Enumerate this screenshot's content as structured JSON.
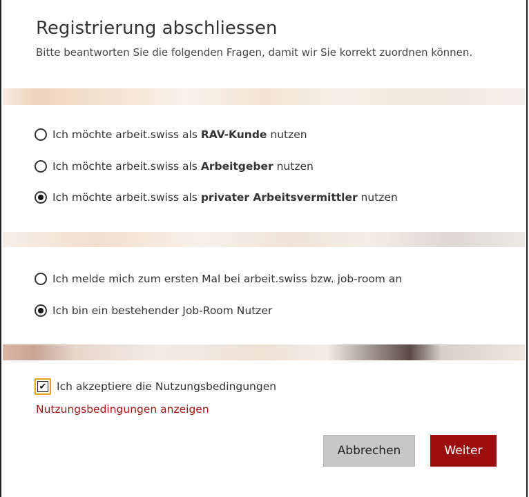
{
  "header": {
    "title": "Registrierung abschliessen",
    "subtitle": "Bitte beantworten Sie die folgenden Fragen, damit wir Sie korrekt zuordnen können."
  },
  "role_options": [
    {
      "prefix": "Ich möchte arbeit.swiss als ",
      "bold": "RAV-Kunde",
      "suffix": " nutzen",
      "checked": false
    },
    {
      "prefix": "Ich möchte arbeit.swiss als ",
      "bold": "Arbeitgeber",
      "suffix": " nutzen",
      "checked": false
    },
    {
      "prefix": "Ich möchte arbeit.swiss als ",
      "bold": "privater Arbeitsvermittler",
      "suffix": " nutzen",
      "checked": true
    }
  ],
  "user_options": [
    {
      "label": "Ich melde mich zum ersten Mal bei arbeit.swiss bzw. job-room an",
      "checked": false
    },
    {
      "label": "Ich bin ein bestehender Job-Room Nutzer",
      "checked": true
    }
  ],
  "terms": {
    "checkbox_label": "Ich akzeptiere die Nutzungsbedingungen",
    "checked": true,
    "link_text": "Nutzungsbedingungen anzeigen"
  },
  "buttons": {
    "cancel_label": "Abbrechen",
    "next_label": "Weiter"
  },
  "colors": {
    "accent_red": "#9c0e0e",
    "link_red": "#a31515",
    "focus_outline": "#e0a21a"
  }
}
